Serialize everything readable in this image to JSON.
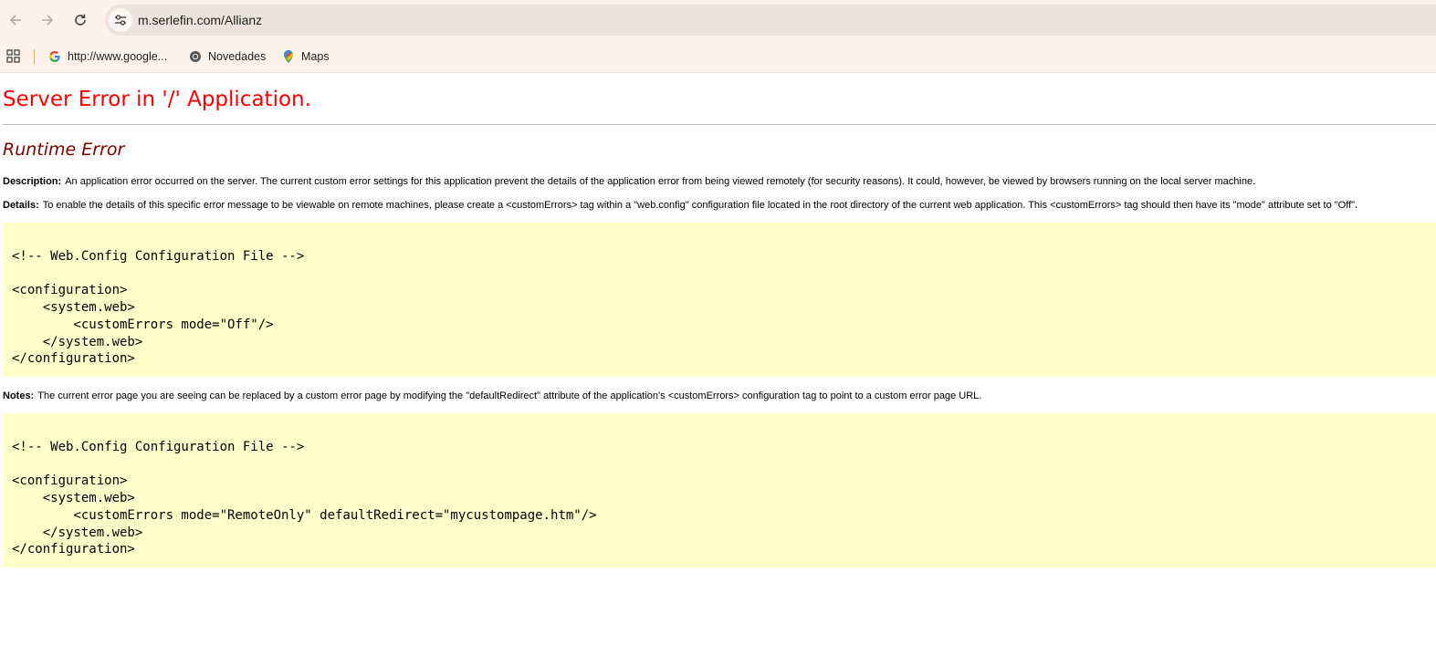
{
  "browser": {
    "url": "m.serlefin.com/Allianz",
    "bookmarks": [
      {
        "label": "http://www.google...",
        "icon": "google-icon"
      },
      {
        "label": "Novedades",
        "icon": "chrome-icon"
      },
      {
        "label": "Maps",
        "icon": "maps-pin-icon"
      }
    ],
    "icons": {
      "back": "back-arrow-icon",
      "forward": "forward-arrow-icon",
      "reload": "reload-icon",
      "site_info": "tune-icon",
      "apps": "apps-grid-icon"
    }
  },
  "page": {
    "title": "Server Error in '/' Application.",
    "error_type": "Runtime Error",
    "description_label": "Description:",
    "description_text": "An application error occurred on the server. The current custom error settings for this application prevent the details of the application error from being viewed remotely (for security reasons). It could, however, be viewed by browsers running on the local server machine.",
    "details_label": "Details:",
    "details_text": "To enable the details of this specific error message to be viewable on remote machines, please create a <customErrors> tag within a \"web.config\" configuration file located in the root directory of the current web application. This <customErrors> tag should then have its \"mode\" attribute set to \"Off\".",
    "code_block_1": "<!-- Web.Config Configuration File -->\n\n<configuration>\n    <system.web>\n        <customErrors mode=\"Off\"/>\n    </system.web>\n</configuration>",
    "notes_label": "Notes:",
    "notes_text": "The current error page you are seeing can be replaced by a custom error page by modifying the \"defaultRedirect\" attribute of the application's <customErrors> configuration tag to point to a custom error page URL.",
    "code_block_2": "<!-- Web.Config Configuration File -->\n\n<configuration>\n    <system.web>\n        <customErrors mode=\"RemoteOnly\" defaultRedirect=\"mycustompage.htm\"/>\n    </system.web>\n</configuration>"
  },
  "colors": {
    "title": "#ff0000",
    "error_type": "#800000",
    "code_background": "#ffffcc",
    "chrome_background": "#fdf3ea"
  }
}
